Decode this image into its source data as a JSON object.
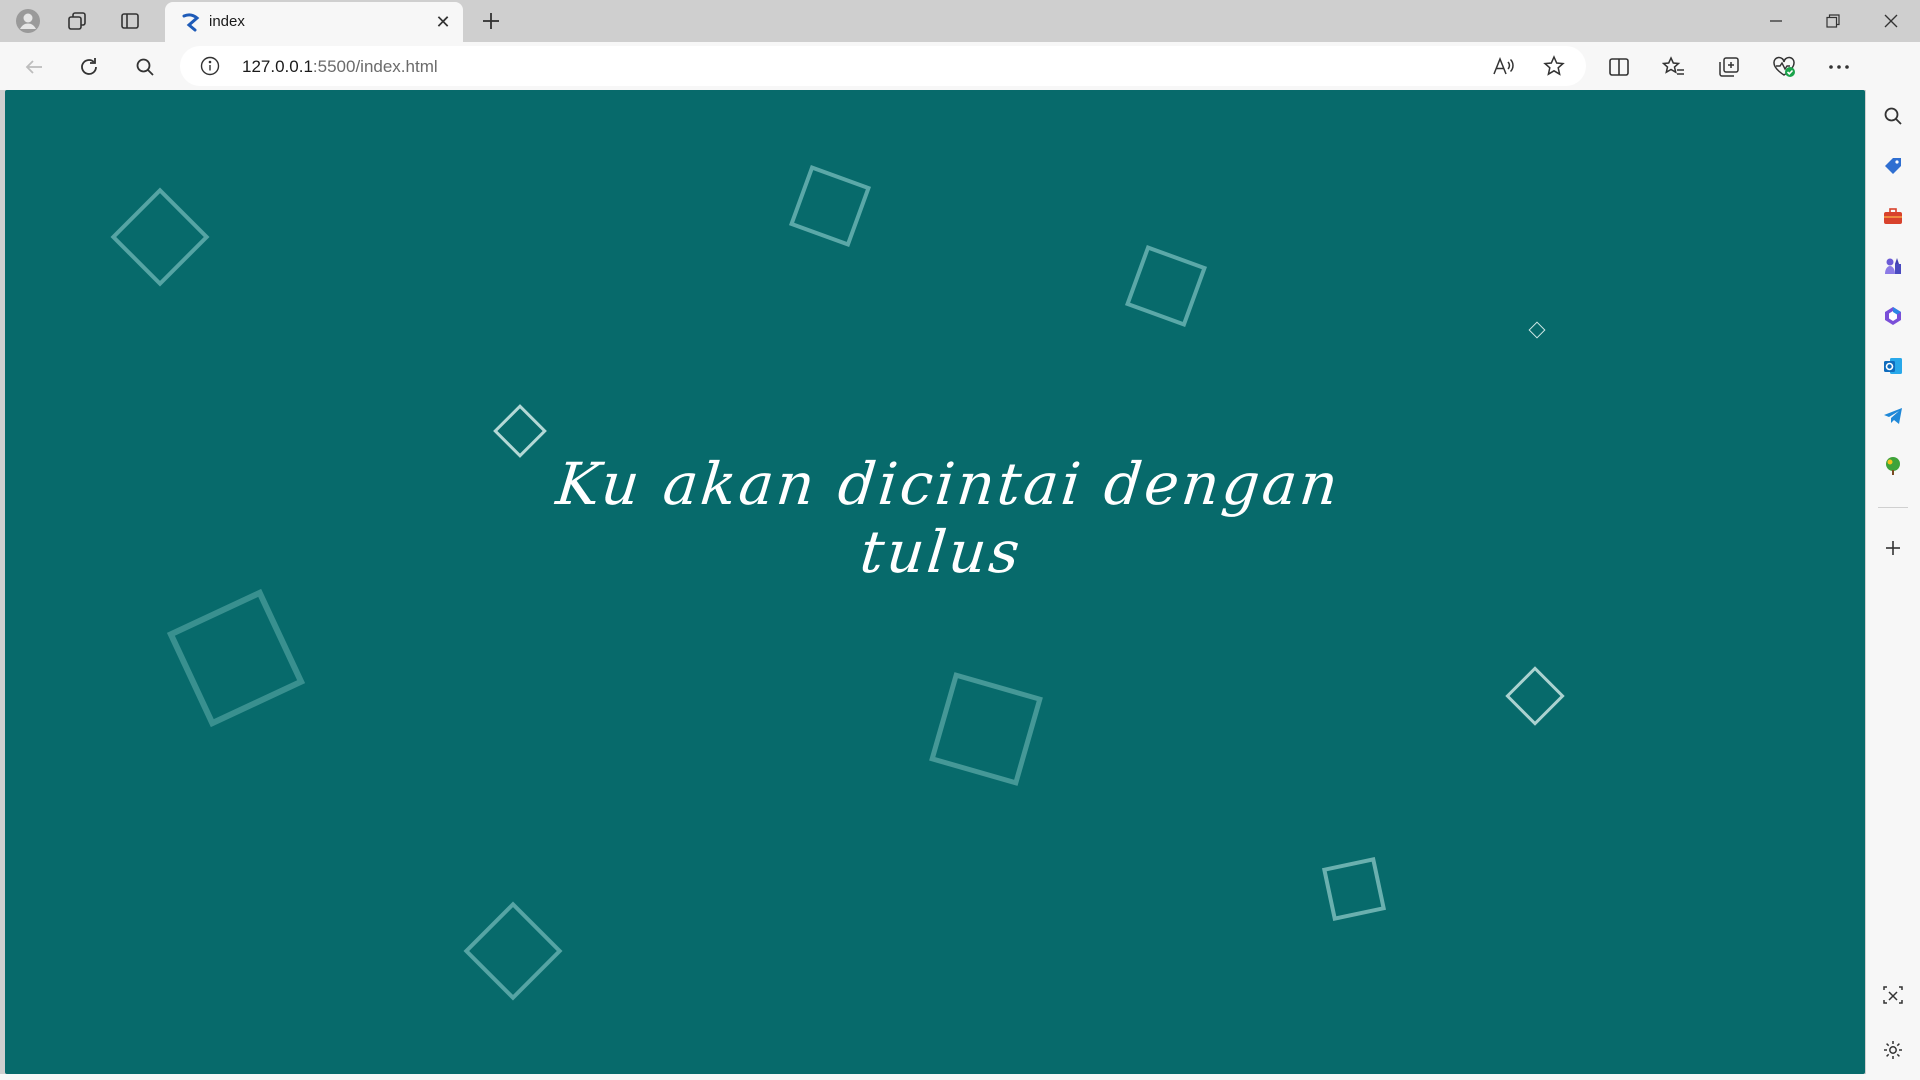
{
  "window": {
    "tab_title": "index",
    "address_host": "127.0.0.1",
    "address_rest": ":5500/index.html"
  },
  "icons": {
    "profile": "profile-icon",
    "workspaces": "workspaces-icon",
    "tab_actions": "tab-actions-icon",
    "favicon": "favicon-icon",
    "close_tab": "close-icon",
    "new_tab": "plus-icon",
    "minimize": "minimize-icon",
    "restore": "restore-icon",
    "close_window": "close-icon",
    "back": "back-arrow-icon",
    "refresh": "refresh-icon",
    "search": "search-icon",
    "site_info": "info-icon",
    "read_aloud": "read-aloud-icon",
    "favorite": "star-icon",
    "split_screen": "split-screen-icon",
    "favorites": "favorites-icon",
    "collections": "collections-icon",
    "browser_essentials": "heart-pulse-icon",
    "more": "more-icon",
    "copilot": "copilot-icon"
  },
  "sidebar": {
    "items": [
      "search-icon",
      "shopping-tag-icon",
      "tools-icon",
      "games-icon",
      "microsoft365-icon",
      "outlook-icon",
      "telegram-icon",
      "drop-icon",
      "add-icon",
      "screenshot-icon",
      "settings-icon"
    ]
  },
  "page": {
    "headline": "Ku akan dicintai dengan tulus",
    "background_color": "#076a6b",
    "text_color": "#ffffff"
  }
}
